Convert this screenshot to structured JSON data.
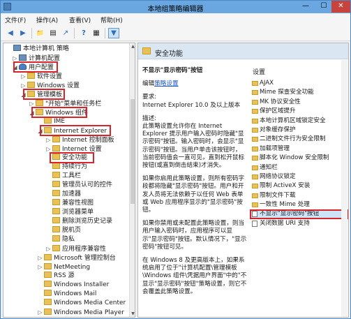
{
  "window": {
    "title": "本地组策略编辑器",
    "min_glyph": "—",
    "max_glyph": "☐",
    "close_glyph": "✕"
  },
  "menu": [
    "文件(F)",
    "操作(A)",
    "查看(V)",
    "帮助(H)"
  ],
  "toolbar_glyphs": {
    "back": "◀",
    "forward": "▶",
    "up": "📁",
    "show": "▤",
    "export": "↗",
    "help": "?",
    "properties": "▦",
    "filter": "▼"
  },
  "tree": {
    "items": [
      {
        "label": "本地计算机 策略",
        "level": 0,
        "icon": "computer-icon",
        "expander": ""
      },
      {
        "label": "计算机配置",
        "level": 1,
        "icon": "computer-icon",
        "expander": "▷"
      },
      {
        "label": "用户配置",
        "level": 1,
        "icon": "user-icon",
        "expander": "◢"
      },
      {
        "label": "软件设置",
        "level": 2,
        "icon": "folder-icon",
        "expander": "▷"
      },
      {
        "label": "Windows 设置",
        "level": 2,
        "icon": "folder-icon",
        "expander": "▷"
      },
      {
        "label": "管理模板",
        "level": 2,
        "icon": "folder-icon",
        "expander": "◢"
      },
      {
        "label": "\"开始\"菜单和任务栏",
        "level": 3,
        "icon": "folder-icon",
        "expander": "▷"
      },
      {
        "label": "Windows 组件",
        "level": 3,
        "icon": "folder-icon",
        "expander": "◢"
      },
      {
        "label": "IME",
        "level": 4,
        "icon": "folder-icon",
        "expander": ""
      },
      {
        "label": "Internet Explorer",
        "level": 4,
        "icon": "folder-icon",
        "expander": "◢"
      },
      {
        "label": "Internet 控制面板",
        "level": 5,
        "icon": "folder-icon",
        "expander": "▷"
      },
      {
        "label": "Internet 设置",
        "level": 5,
        "icon": "folder-icon",
        "expander": "▷"
      },
      {
        "label": "安全功能",
        "level": 5,
        "icon": "folder-icon",
        "expander": ""
      },
      {
        "label": "持续行为",
        "level": 5,
        "icon": "folder-icon",
        "expander": ""
      },
      {
        "label": "工具栏",
        "level": 5,
        "icon": "folder-icon",
        "expander": ""
      },
      {
        "label": "管理员认可的控件",
        "level": 5,
        "icon": "folder-icon",
        "expander": ""
      },
      {
        "label": "加速器",
        "level": 5,
        "icon": "folder-icon",
        "expander": ""
      },
      {
        "label": "兼容性视图",
        "level": 5,
        "icon": "folder-icon",
        "expander": ""
      },
      {
        "label": "浏览器菜单",
        "level": 5,
        "icon": "folder-icon",
        "expander": ""
      },
      {
        "label": "删除浏览历史记录",
        "level": 5,
        "icon": "folder-icon",
        "expander": ""
      },
      {
        "label": "脱机页",
        "level": 5,
        "icon": "folder-icon",
        "expander": ""
      },
      {
        "label": "隐私",
        "level": 5,
        "icon": "folder-icon",
        "expander": ""
      },
      {
        "label": "应用程序兼容性",
        "level": 5,
        "icon": "folder-icon",
        "expander": "▷"
      },
      {
        "label": "Microsoft 管理控制台",
        "level": 4,
        "icon": "folder-icon",
        "expander": "▷"
      },
      {
        "label": "NetMeeting",
        "level": 4,
        "icon": "folder-icon",
        "expander": "▷"
      },
      {
        "label": "RSS 源",
        "level": 4,
        "icon": "folder-icon",
        "expander": ""
      },
      {
        "label": "Windows Installer",
        "level": 4,
        "icon": "folder-icon",
        "expander": ""
      },
      {
        "label": "Windows Mail",
        "level": 4,
        "icon": "folder-icon",
        "expander": ""
      },
      {
        "label": "Windows Media Center",
        "level": 4,
        "icon": "folder-icon",
        "expander": ""
      },
      {
        "label": "Windows Media Player",
        "level": 4,
        "icon": "folder-icon",
        "expander": "▷"
      }
    ],
    "scroll_up": "▲",
    "scroll_down": "▼"
  },
  "right": {
    "header_title": "安全功能",
    "policy_title": "不显示\"显示密码\"按钮",
    "edit_prefix": "编辑",
    "edit_link": "策略设置",
    "requirement_label": "要求:",
    "requirement_text": "Internet Explorer 10.0 及以上版本",
    "description_label": "描述:",
    "description_1": "此策略设置允许你在 Internet Explorer 提示用户输入密码时隐藏\"显示密码\"按钮。输入密码时，会显示\"显示密码\"按钮。当用户单击该按钮时，当前密码值会一直可见，直到松开鼠标按钮(或直到倒击结束)才消失。",
    "description_2": "如果你启用此策略设置，则所有密码字段都将隐藏\"显示密码\"按钮。用户和开发人员将无法依赖于以任何 Web 表单或 Web 应用程序显示的\"显示密码\"按钮。",
    "description_3": "如果你禁用或未配置此策略设置，则当用户输入密码时，应用程序可以显示\"显示密码\"按钮。默认情况下，\"显示密码\"按钮可见。",
    "description_4": "在 Windows 8 及更高版本上，如果系统启用了位于\"计算机配置\\管理模板\\Windows 组件\\凭据用户界面\"中的\"不显示\"显示密码\"按钮\"策略设置，则它不会覆盖此策略设置。",
    "settings_header": "设置",
    "settings": [
      {
        "label": "AJAX",
        "icon": "folder-icon"
      },
      {
        "label": "Mime 探查安全功能",
        "icon": "folder-icon"
      },
      {
        "label": "MK 协议安全性",
        "icon": "folder-icon"
      },
      {
        "label": "保护区域提升",
        "icon": "folder-icon"
      },
      {
        "label": "本地计算机区域锁定安全",
        "icon": "folder-icon"
      },
      {
        "label": "对象缓存保护",
        "icon": "folder-icon"
      },
      {
        "label": "二进制文件行为安全限制",
        "icon": "folder-icon"
      },
      {
        "label": "加载项管理",
        "icon": "folder-icon"
      },
      {
        "label": "脚本化 Window 安全限制",
        "icon": "folder-icon"
      },
      {
        "label": "通知栏",
        "icon": "folder-icon"
      },
      {
        "label": "网络协议锁定",
        "icon": "folder-icon"
      },
      {
        "label": "限制 ActiveX 安装",
        "icon": "folder-icon"
      },
      {
        "label": "限制文件下载",
        "icon": "folder-icon"
      },
      {
        "label": "一致性 Mime 处理",
        "icon": "folder-icon"
      },
      {
        "label": "不显示\"显示密码\"按钮",
        "icon": "document-icon"
      },
      {
        "label": "关闭数据 URI 支持",
        "icon": "document-icon"
      }
    ]
  },
  "colors": {
    "highlight": "#d8232a",
    "selection": "#cde4f7",
    "link": "#1a55b8"
  }
}
